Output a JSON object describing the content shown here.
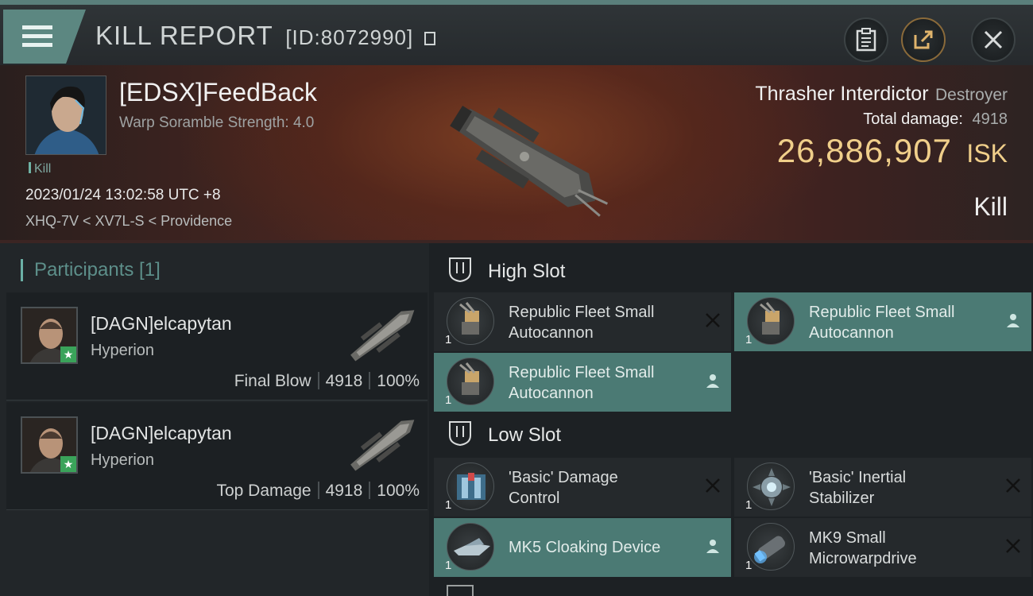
{
  "header": {
    "title": "KILL REPORT",
    "kill_id": "[ID:8072990]"
  },
  "victim": {
    "name": "[EDSX]FeedBack",
    "scramble": "Warp Soramble Strength: 4.0",
    "kill_tag": "Kill",
    "time": "2023/01/24 13:02:58 UTC +8",
    "location": "XHQ-7V < XV7L-S < Providence",
    "ship_name": "Thrasher Interdictor",
    "ship_class": "Destroyer",
    "total_damage_label": "Total damage:",
    "total_damage": "4918",
    "isk_value": "26,886,907",
    "isk_unit": "ISK",
    "result": "Kill"
  },
  "participants": {
    "title": "Participants [1]",
    "items": [
      {
        "name": "[DAGN]elcapytan",
        "ship": "Hyperion",
        "role": "Final Blow",
        "damage": "4918",
        "percent": "100%"
      },
      {
        "name": "[DAGN]elcapytan",
        "ship": "Hyperion",
        "role": "Top Damage",
        "damage": "4918",
        "percent": "100%"
      }
    ]
  },
  "fitting": {
    "high_slot_label": "High Slot",
    "low_slot_label": "Low Slot",
    "high": [
      {
        "line1": "Republic Fleet Small",
        "line2": "Autocannon",
        "qty": "1",
        "status": "destroyed"
      },
      {
        "line1": "Republic Fleet Small",
        "line2": "Autocannon",
        "qty": "1",
        "status": "dropped"
      },
      {
        "line1": "Republic Fleet Small",
        "line2": "Autocannon",
        "qty": "1",
        "status": "dropped"
      }
    ],
    "low": [
      {
        "line1": "'Basic' Damage",
        "line2": "Control",
        "qty": "1",
        "status": "destroyed"
      },
      {
        "line1": "'Basic' Inertial",
        "line2": "Stabilizer",
        "qty": "1",
        "status": "destroyed"
      },
      {
        "line1": "MK5 Cloaking Device",
        "qty": "1",
        "status": "dropped"
      },
      {
        "line1": "MK9 Small",
        "line2": "Microwarpdrive",
        "qty": "1",
        "status": "destroyed"
      }
    ]
  },
  "colors": {
    "accent": "#5c8781",
    "isk": "#f0cf8a",
    "active_module": "#4b7a74",
    "badge_green": "#3aa35a"
  }
}
